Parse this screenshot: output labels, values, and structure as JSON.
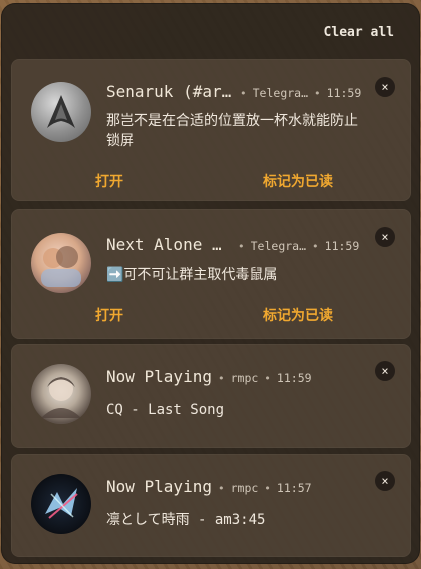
{
  "header": {
    "clear_all_label": "Clear all"
  },
  "notifications": [
    {
      "title": "Senaruk (#arc…",
      "app": "Telegra…",
      "time": "11:59",
      "body": "那岂不是在合适的位置放一杯水就能防止锁屏",
      "actions": [
        "打开",
        "标记为已读"
      ],
      "close_label": "×"
    },
    {
      "title": "Next Alone 👻…",
      "app": "Telegra…",
      "time": "11:59",
      "body": "➡️可不可让群主取代毒鼠属",
      "actions": [
        "打开",
        "标记为已读"
      ],
      "close_label": "×"
    },
    {
      "title": "Now Playing",
      "app": "rmpc",
      "time": "11:59",
      "body": "CQ - Last Song",
      "close_label": "×"
    },
    {
      "title": "Now Playing",
      "app": "rmpc",
      "time": "11:57",
      "body": "凛として時雨 - am3:45",
      "close_label": "×"
    }
  ],
  "colors": {
    "accent": "#f0a830",
    "panel": "#28221c",
    "card": "#645444",
    "text": "#efe7dc"
  }
}
